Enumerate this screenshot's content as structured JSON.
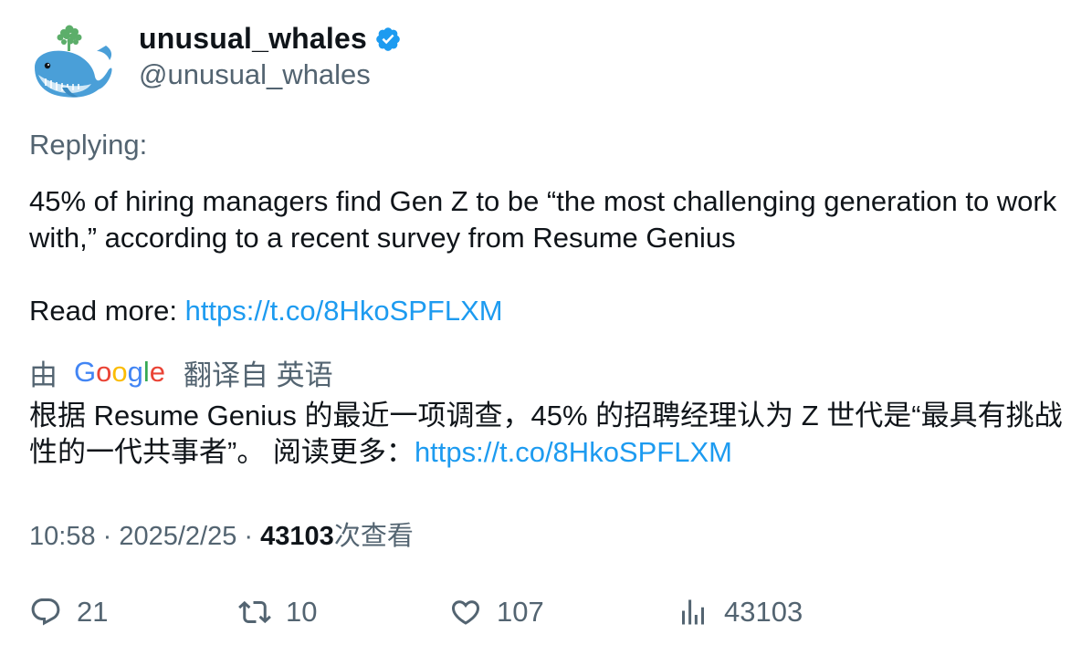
{
  "user": {
    "display_name": "unusual_whales",
    "handle": "@unusual_whales",
    "verified": true,
    "verified_color": "#1d9bf0"
  },
  "tweet": {
    "replying_label": "Replying:",
    "text_line1": "45% of hiring managers find Gen Z to be “the most challenging generation to work with,” according to a recent survey from Resume Genius",
    "read_more_label": "Read more: ",
    "link": "https://t.co/8HkoSPFLXM"
  },
  "translation": {
    "prefix": "由",
    "provider": "Google",
    "suffix": "翻译自 英语",
    "text": "根据 Resume Genius 的最近一项调查，45% 的招聘经理认为 Z 世代是“最具有挑战性的一代共事者”。 阅读更多：",
    "link": "https://t.co/8HkoSPFLXM"
  },
  "meta": {
    "time": "10:58",
    "separator": " · ",
    "date": "2025/2/25",
    "views_count": "43103",
    "views_label": "次查看"
  },
  "actions": {
    "replies": "21",
    "retweets": "10",
    "likes": "107",
    "views": "43103"
  },
  "colors": {
    "text": "#0f1419",
    "secondary": "#536471",
    "link": "#1d9bf0"
  },
  "icons": [
    "whale-avatar",
    "verified-badge-icon",
    "google-logo",
    "reply-icon",
    "retweet-icon",
    "like-icon",
    "views-icon"
  ]
}
